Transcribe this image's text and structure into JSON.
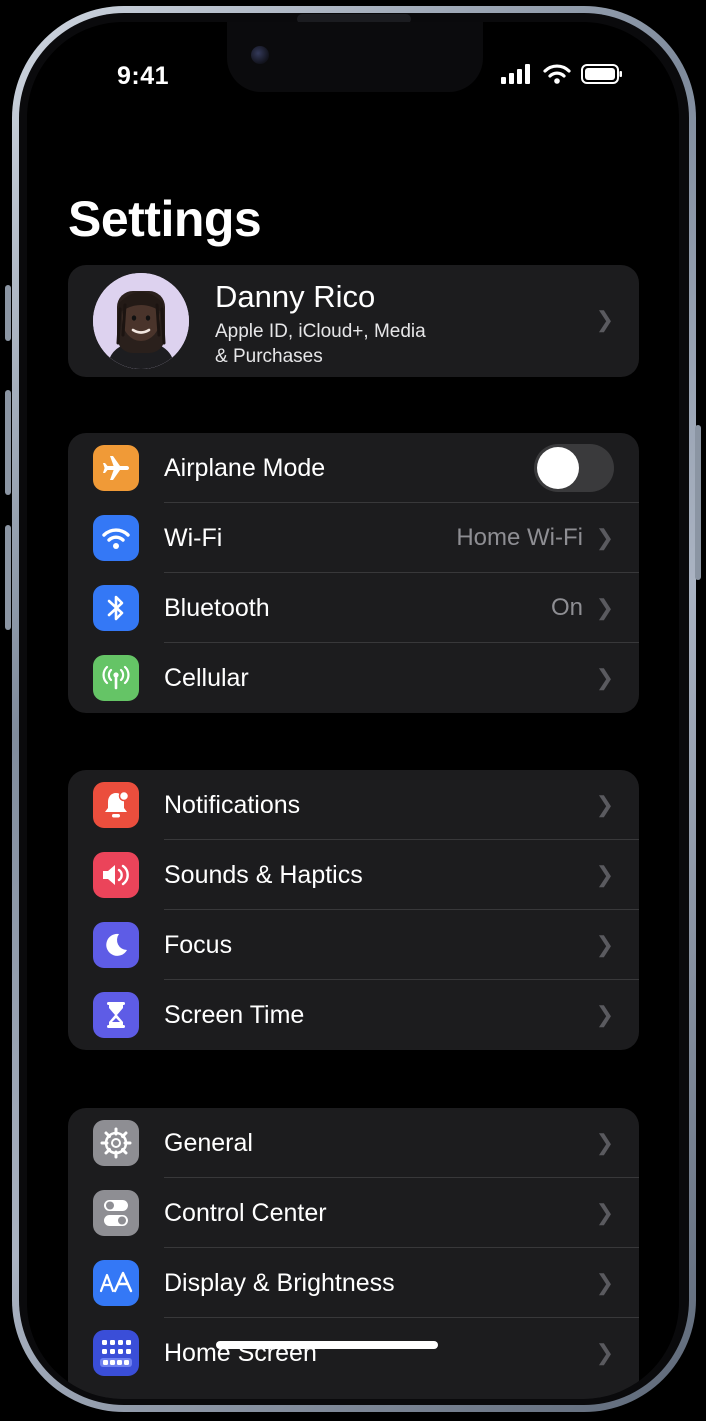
{
  "status": {
    "time": "9:41"
  },
  "page": {
    "title": "Settings"
  },
  "profile": {
    "name": "Danny Rico",
    "subtitle_line1": "Apple ID, iCloud+, Media",
    "subtitle_line2": "& Purchases"
  },
  "group1": [
    {
      "label": "Airplane Mode",
      "icon": "airplane-icon",
      "color": "#f09a37",
      "toggle": false
    },
    {
      "label": "Wi-Fi",
      "icon": "wifi-icon",
      "color": "#3478f6",
      "value": "Home Wi-Fi"
    },
    {
      "label": "Bluetooth",
      "icon": "bluetooth-icon",
      "color": "#3478f6",
      "value": "On"
    },
    {
      "label": "Cellular",
      "icon": "cellular-icon",
      "color": "#65c466"
    }
  ],
  "group2": [
    {
      "label": "Notifications",
      "icon": "bell-icon",
      "color": "#eb4e3d"
    },
    {
      "label": "Sounds & Haptics",
      "icon": "speaker-icon",
      "color": "#eb445a"
    },
    {
      "label": "Focus",
      "icon": "moon-icon",
      "color": "#5e5ce6"
    },
    {
      "label": "Screen Time",
      "icon": "hourglass-icon",
      "color": "#5e5ce6"
    }
  ],
  "group3": [
    {
      "label": "General",
      "icon": "gear-icon",
      "color": "#8e8e93"
    },
    {
      "label": "Control Center",
      "icon": "switches-icon",
      "color": "#8e8e93"
    },
    {
      "label": "Display & Brightness",
      "icon": "text-size-icon",
      "color": "#3478f6"
    },
    {
      "label": "Home Screen",
      "icon": "home-grid-icon",
      "color": "#3a4ed8"
    }
  ]
}
